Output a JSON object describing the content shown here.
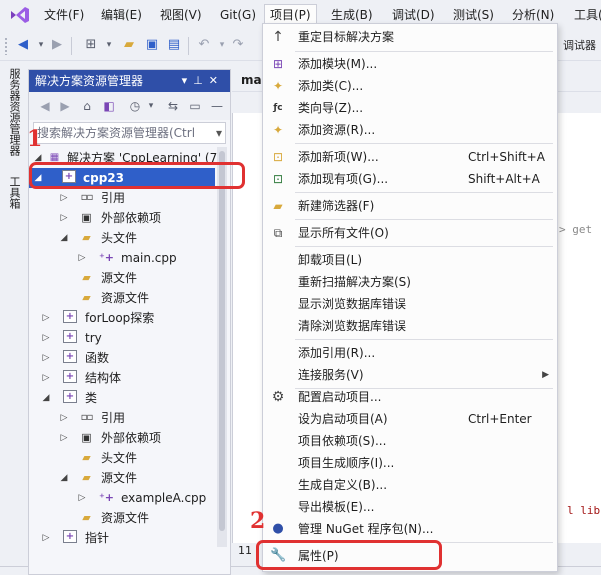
{
  "menubar": {
    "items": [
      "文件(F)",
      "编辑(E)",
      "视图(V)",
      "Git(G)",
      "项目(P)",
      "生成(B)",
      "调试(D)",
      "测试(S)",
      "分析(N)",
      "工具("
    ]
  },
  "toolbar": {
    "right_label": "调试器"
  },
  "side_strip": {
    "items": [
      "服务器资源管理器",
      "工具箱"
    ]
  },
  "solution_explorer": {
    "title": "解决方案资源管理器",
    "search_placeholder": "搜索解决方案资源管理器(Ctrl",
    "tree": [
      {
        "label": "解决方案 'CppLearning' (7",
        "icon": "solution-icon",
        "level": 0,
        "expanded": true
      },
      {
        "label": "cpp23",
        "icon": "project-icon",
        "level": 0,
        "expanded": true,
        "selected": true
      },
      {
        "label": "引用",
        "icon": "references-icon",
        "level": 1,
        "expanded": false
      },
      {
        "label": "外部依赖项",
        "icon": "external-deps-icon",
        "level": 1,
        "expanded": false
      },
      {
        "label": "头文件",
        "icon": "folder-icon",
        "level": 1,
        "expanded": true
      },
      {
        "label": "main.cpp",
        "icon": "cpp-file-icon",
        "level": 2,
        "expanded": false
      },
      {
        "label": "源文件",
        "icon": "folder-icon",
        "level": 1
      },
      {
        "label": "资源文件",
        "icon": "folder-icon",
        "level": 1
      },
      {
        "label": "forLoop探索",
        "icon": "project-icon",
        "level": 0,
        "expanded": false
      },
      {
        "label": "try",
        "icon": "project-icon",
        "level": 0,
        "expanded": false
      },
      {
        "label": "函数",
        "icon": "project-icon",
        "level": 0,
        "expanded": false
      },
      {
        "label": "结构体",
        "icon": "project-icon",
        "level": 0,
        "expanded": false
      },
      {
        "label": "类",
        "icon": "project-icon",
        "level": 0,
        "expanded": true
      },
      {
        "label": "引用",
        "icon": "references-icon",
        "level": 1,
        "expanded": false
      },
      {
        "label": "外部依赖项",
        "icon": "external-deps-icon",
        "level": 1,
        "expanded": false
      },
      {
        "label": "头文件",
        "icon": "folder-icon",
        "level": 1
      },
      {
        "label": "源文件",
        "icon": "folder-icon",
        "level": 1,
        "expanded": true
      },
      {
        "label": "exampleA.cpp",
        "icon": "cpp-file-icon",
        "level": 2,
        "expanded": false
      },
      {
        "label": "资源文件",
        "icon": "folder-icon",
        "level": 1
      },
      {
        "label": "指针",
        "icon": "project-icon",
        "level": 0,
        "expanded": false
      }
    ]
  },
  "editor": {
    "tab_label": "mai",
    "code_fragment_1": "> get",
    "code_fragment_2": "l libr",
    "status_text": "11"
  },
  "project_menu": {
    "items": [
      {
        "label": "重定目标解决方案",
        "shortcut": "",
        "icon": "arrow-up-icon"
      },
      {
        "label": "添加模块(M)...",
        "shortcut": "",
        "icon": "add-module-icon"
      },
      {
        "label": "添加类(C)...",
        "shortcut": "",
        "icon": "add-class-icon"
      },
      {
        "label": "类向导(Z)...",
        "shortcut": "",
        "icon": "class-wizard-icon"
      },
      {
        "label": "添加资源(R)...",
        "shortcut": "",
        "icon": "add-resource-icon"
      },
      {
        "label": "添加新项(W)...",
        "shortcut": "Ctrl+Shift+A",
        "icon": "add-new-item-icon"
      },
      {
        "label": "添加现有项(G)...",
        "shortcut": "Shift+Alt+A",
        "icon": "add-existing-item-icon"
      },
      {
        "label": "新建筛选器(F)",
        "shortcut": "",
        "icon": "new-filter-icon"
      },
      {
        "label": "显示所有文件(O)",
        "shortcut": "",
        "icon": "show-all-files-icon"
      },
      {
        "label": "卸载项目(L)",
        "shortcut": "",
        "icon": ""
      },
      {
        "label": "重新扫描解决方案(S)",
        "shortcut": "",
        "icon": ""
      },
      {
        "label": "显示浏览数据库错误",
        "shortcut": "",
        "icon": ""
      },
      {
        "label": "清除浏览数据库错误",
        "shortcut": "",
        "icon": ""
      },
      {
        "label": "添加引用(R)...",
        "shortcut": "",
        "icon": ""
      },
      {
        "label": "连接服务(V)",
        "shortcut": "",
        "icon": "",
        "submenu": true
      },
      {
        "label": "配置启动项目...",
        "shortcut": "",
        "icon": "gear-icon"
      },
      {
        "label": "设为启动项目(A)",
        "shortcut": "Ctrl+Enter",
        "icon": ""
      },
      {
        "label": "项目依赖项(S)...",
        "shortcut": "",
        "icon": ""
      },
      {
        "label": "项目生成顺序(I)...",
        "shortcut": "",
        "icon": ""
      },
      {
        "label": "生成自定义(B)...",
        "shortcut": "",
        "icon": ""
      },
      {
        "label": "导出模板(E)...",
        "shortcut": "",
        "icon": ""
      },
      {
        "label": "管理 NuGet 程序包(N)...",
        "shortcut": "",
        "icon": "nuget-icon"
      },
      {
        "label": "属性(P)",
        "shortcut": "",
        "icon": "wrench-icon"
      }
    ]
  },
  "annotations": {
    "step1": "1",
    "step2": "2"
  },
  "colors": {
    "accent": "#2f5fc9",
    "title_bar": "#2f4fa8",
    "annotation": "#e03131"
  }
}
